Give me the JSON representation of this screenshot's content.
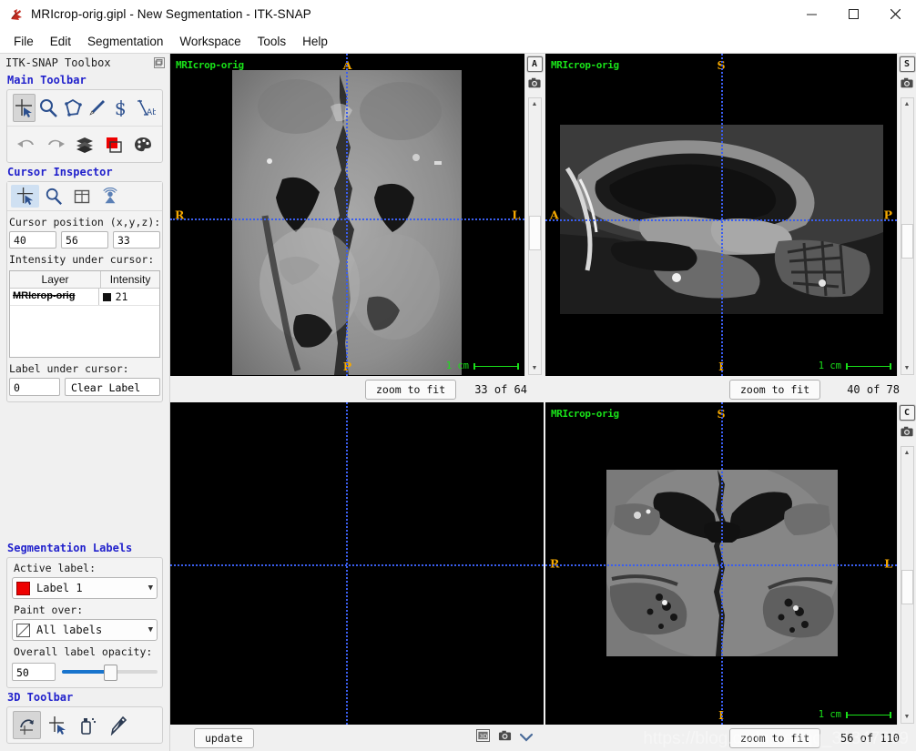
{
  "window": {
    "title": "MRIcrop-orig.gipl - New Segmentation - ITK-SNAP",
    "minimize": "—",
    "maximize": "☐",
    "close": "✕"
  },
  "menu": {
    "items": [
      {
        "label": "File"
      },
      {
        "label": "Edit"
      },
      {
        "label": "Segmentation"
      },
      {
        "label": "Workspace"
      },
      {
        "label": "Tools"
      },
      {
        "label": "Help"
      }
    ]
  },
  "toolbox": {
    "header": "ITK-SNAP Toolbox",
    "main_toolbar": {
      "title": "Main Toolbar",
      "row1": [
        {
          "name": "crosshair-tool",
          "active": true
        },
        {
          "name": "zoom-pan-tool",
          "active": false
        },
        {
          "name": "polygon-tool",
          "active": false
        },
        {
          "name": "paintbrush-tool",
          "active": false
        },
        {
          "name": "snake-tool",
          "active": false
        },
        {
          "name": "annotation-tool",
          "active": false
        }
      ],
      "row2": [
        {
          "name": "undo-button"
        },
        {
          "name": "redo-button"
        },
        {
          "name": "layer-inspector-button"
        },
        {
          "name": "label-editor-button"
        },
        {
          "name": "color-map-button"
        }
      ]
    },
    "cursor_inspector": {
      "title": "Cursor Inspector",
      "tabs": [
        {
          "name": "cursor-tab",
          "active": true
        },
        {
          "name": "zoom-tab",
          "active": false
        },
        {
          "name": "display-layout-tab",
          "active": false
        },
        {
          "name": "3d-panel-tab",
          "active": false
        }
      ],
      "cursor_position_label": "Cursor position (x,y,z):",
      "cursor_position": {
        "x": "40",
        "y": "56",
        "z": "33"
      },
      "intensity_label": "Intensity under cursor:",
      "intensity_table": {
        "columns": [
          "Layer",
          "Intensity"
        ],
        "rows": [
          {
            "layer": "MRIcrop-orig",
            "swatch": "#111111",
            "intensity": "21"
          }
        ]
      },
      "label_under_cursor_label": "Label under cursor:",
      "label_under_cursor_value": "0",
      "label_under_cursor_name": "Clear Label"
    },
    "segmentation_labels": {
      "title": "Segmentation Labels",
      "active_label_caption": "Active label:",
      "active_label_value": "Label 1",
      "active_label_color": "#ee0000",
      "paint_over_caption": "Paint over:",
      "paint_over_value": "All labels",
      "opacity_caption": "Overall label opacity:",
      "opacity_value": "50"
    },
    "toolbar_3d": {
      "title": "3D Toolbar",
      "buttons": [
        {
          "name": "3d-trackball-tool",
          "active": true
        },
        {
          "name": "3d-crosshair-tool",
          "active": false
        },
        {
          "name": "3d-spray-tool",
          "active": false
        },
        {
          "name": "3d-scalpel-tool",
          "active": false
        }
      ]
    }
  },
  "panes": {
    "axial": {
      "overlay_name": "MRIcrop-orig",
      "side_letter": "A",
      "dir_top": "A",
      "dir_bottom": "P",
      "dir_left": "R",
      "dir_right": "L",
      "scale_label": "1  cm",
      "zoom_button": "zoom to fit",
      "slice_counter": "33 of 64"
    },
    "sagittal": {
      "overlay_name": "MRIcrop-orig",
      "side_letter": "S",
      "dir_top": "S",
      "dir_bottom": "I",
      "dir_left": "A",
      "dir_right": "P",
      "scale_label": "1  cm",
      "zoom_button": "zoom to fit",
      "slice_counter": "40 of 78"
    },
    "render3d": {
      "update_button": "update",
      "icons": [
        "3d-view-icon",
        "snapshot-icon",
        "chevron-down-icon"
      ]
    },
    "coronal": {
      "overlay_name": "MRIcrop-orig",
      "side_letter": "C",
      "dir_top": "S",
      "dir_bottom": "I",
      "dir_left": "R",
      "dir_right": "L",
      "scale_label": "1  cm",
      "zoom_button": "zoom to fit",
      "slice_counter": "56 of 110"
    }
  },
  "watermark": "https://blog.csdn.net/qq_31347869"
}
